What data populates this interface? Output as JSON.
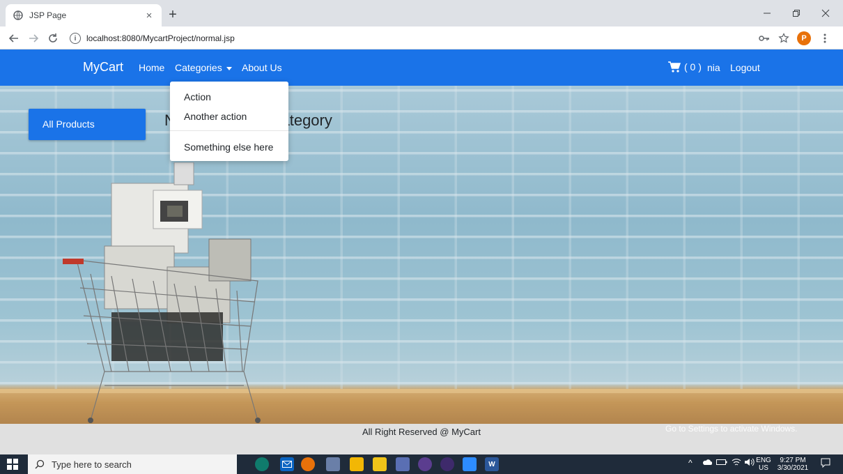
{
  "browser": {
    "tab_title": "JSP Page",
    "tab_close": "×",
    "new_tab": "+",
    "url": "localhost:8080/MycartProject/normal.jsp",
    "avatar_letter": "P"
  },
  "navbar": {
    "brand": "MyCart",
    "links": [
      "Home",
      "Categories",
      "About Us"
    ],
    "cart_count": "( 0 )",
    "user": "nia",
    "logout": "Logout"
  },
  "dropdown": {
    "items": [
      "Action",
      "Another action",
      "Something else here"
    ]
  },
  "main": {
    "all_products": "All Products",
    "heading": "No items in this category"
  },
  "footer": {
    "text": "All Right Reserved @ MyCart",
    "watermark": "Go to Settings to activate Windows."
  },
  "taskbar": {
    "search_placeholder": "Type here to search",
    "lang_top": "ENG",
    "lang_bottom": "US",
    "time": "9:27 PM",
    "date": "3/30/2021"
  },
  "colors": {
    "primary": "#1a73e8",
    "taskbar": "#1f2b3a"
  }
}
